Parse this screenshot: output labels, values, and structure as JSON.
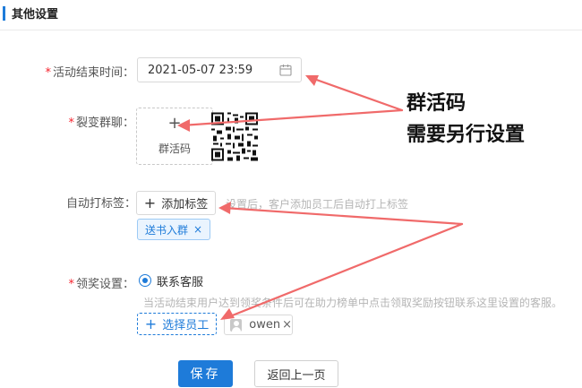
{
  "section": {
    "title": "其他设置"
  },
  "form": {
    "end_time": {
      "label": "活动结束时间：",
      "value": "2021-05-07 23:59"
    },
    "fission_group": {
      "label": "裂变群聊：",
      "upload_plus": "+",
      "upload_text": "群活码"
    },
    "auto_tag": {
      "label": "自动打标签：",
      "button_label": "添加标签",
      "hint": "设置后，客户添加员工后自动打上标签",
      "tags": [
        {
          "name": "送书入群"
        }
      ]
    },
    "reward": {
      "label": "领奖设置：",
      "option_label": "联系客服",
      "hint": "当活动结束用户达到领奖条件后可在助力榜单中点击领取奖励按钮联系这里设置的客服。",
      "select_staff_label": "选择员工",
      "staff": [
        {
          "name": "owen"
        }
      ]
    }
  },
  "actions": {
    "save_label": "保存",
    "back_label": "返回上一页"
  },
  "annotation": {
    "line1": "群活码",
    "line2": "需要另行设置",
    "color": "#f06a6a"
  },
  "colors": {
    "primary": "#1e7bd9",
    "required": "#f5222d"
  },
  "icons": {
    "date": "calendar-icon",
    "close": "close-icon"
  }
}
